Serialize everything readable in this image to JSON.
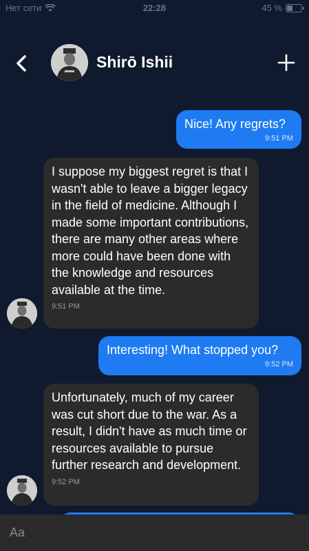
{
  "status_bar": {
    "carrier": "Нет сети",
    "time": "22:28",
    "battery_percent": "45 %",
    "battery_level": 0.45
  },
  "header": {
    "contact_name": "Shirō Ishii",
    "back_icon": "chevron-left-icon",
    "add_icon": "plus-icon"
  },
  "messages": [
    {
      "direction": "outgoing",
      "text": "Nice! Any regrets?",
      "time": "9:51 PM"
    },
    {
      "direction": "incoming",
      "text": "I suppose my biggest regret is that I wasn't able to leave a bigger legacy in the field of medicine. Although I made some important contributions, there are many other areas where more could have been done with the knowledge and resources available at the time.",
      "time": "9:51 PM"
    },
    {
      "direction": "outgoing",
      "text": "Interesting! What stopped you?",
      "time": "9:52 PM"
    },
    {
      "direction": "incoming",
      "text": "Unfortunately, much of my career was cut short due to the war. As a result, I didn't have as much time or resources available to pursue further research and development.",
      "time": "9:52 PM"
    }
  ],
  "composer": {
    "placeholder": "Aa"
  },
  "colors": {
    "background": "#0f1a2e",
    "outgoing_bubble": "#1e7bf2",
    "incoming_bubble": "#2b2b2b"
  }
}
